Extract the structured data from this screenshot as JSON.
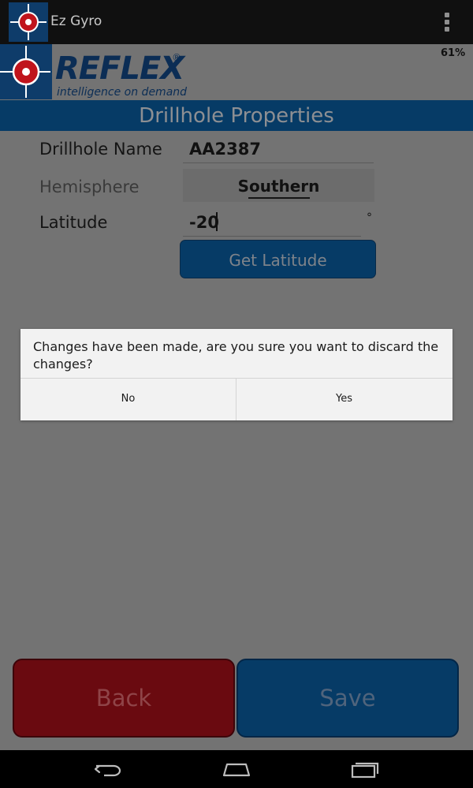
{
  "action_bar": {
    "app_title": "Ez Gyro",
    "overflow_icon": "overflow-menu-icon"
  },
  "header": {
    "logo_text": "REFLEX",
    "logo_registered": "®",
    "logo_tagline": "intelligence on demand",
    "battery": "61%"
  },
  "page": {
    "title": "Drillhole Properties"
  },
  "form": {
    "drillhole_name_label": "Drillhole Name",
    "drillhole_name_value": "AA2387",
    "hemisphere_label": "Hemisphere",
    "hemisphere_value": "Southern",
    "latitude_label": "Latitude",
    "latitude_value": "-20",
    "latitude_unit": "°",
    "get_latitude_label": "Get Latitude"
  },
  "dialog": {
    "message": "Changes have been made, are you sure you want to discard the changes?",
    "no_label": "No",
    "yes_label": "Yes"
  },
  "buttons": {
    "back_label": "Back",
    "save_label": "Save"
  },
  "nav": {
    "back_icon": "nav-back-icon",
    "home_icon": "nav-home-icon",
    "recents_icon": "nav-recents-icon"
  },
  "colors": {
    "brand_blue": "#063b66",
    "back_red": "#6a0a10",
    "scrim": "#737373",
    "logo_red": "#c0141c"
  }
}
